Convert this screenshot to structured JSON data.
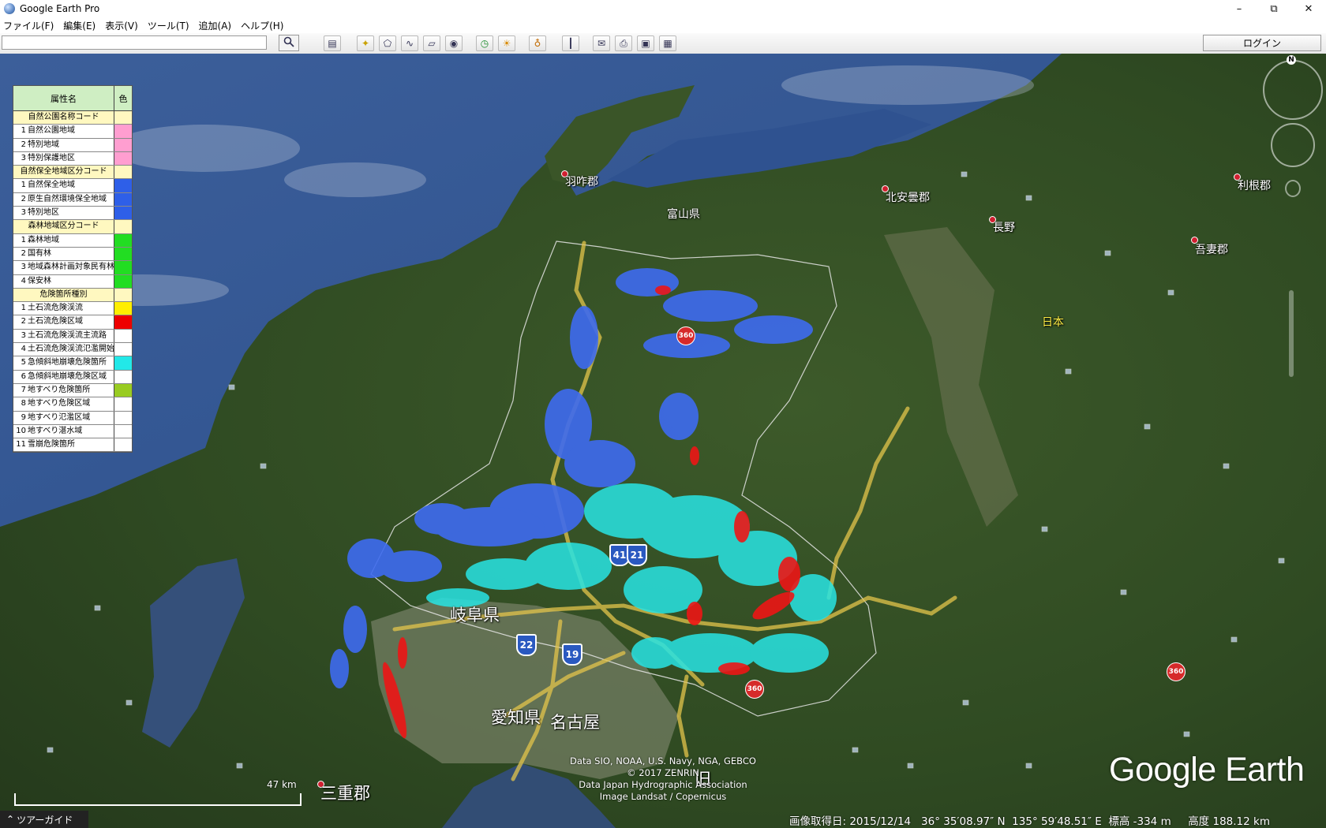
{
  "window": {
    "title": "Google Earth Pro",
    "minimize": "–",
    "restore": "⧉",
    "close": "✕"
  },
  "menu": [
    "ファイル(F)",
    "編集(E)",
    "表示(V)",
    "ツール(T)",
    "追加(A)",
    "ヘルプ(H)"
  ],
  "toolbar": {
    "search_value": "",
    "login_label": "ログイン",
    "buttons": [
      "sidebar-toggle-icon",
      "placemark-icon",
      "polygon-icon",
      "path-icon",
      "overlay-icon",
      "tour-icon",
      "historical-imagery-icon",
      "sunlight-icon",
      "planet-icon",
      "ruler-icon",
      "email-icon",
      "print-icon",
      "save-image-icon",
      "view-in-maps-icon"
    ]
  },
  "legend": {
    "header_name": "属性名",
    "header_color": "色",
    "rows": [
      {
        "type": "section",
        "label": "自然公園名称コード",
        "color": ""
      },
      {
        "type": "item",
        "idx": "1",
        "label": "自然公園地域",
        "color": "#ff9ed0"
      },
      {
        "type": "item",
        "idx": "2",
        "label": "特別地域",
        "color": "#ff9ed0"
      },
      {
        "type": "item",
        "idx": "3",
        "label": "特別保護地区",
        "color": "#ff9ed0"
      },
      {
        "type": "section",
        "label": "自然保全地域区分コード",
        "color": ""
      },
      {
        "type": "item",
        "idx": "1",
        "label": "自然保全地域",
        "color": "#2e5fe8"
      },
      {
        "type": "item",
        "idx": "2",
        "label": "原生自然環境保全地域",
        "color": "#2e5fe8"
      },
      {
        "type": "item",
        "idx": "3",
        "label": "特別地区",
        "color": "#2e5fe8"
      },
      {
        "type": "section",
        "label": "森林地域区分コード",
        "color": ""
      },
      {
        "type": "item",
        "idx": "1",
        "label": "森林地域",
        "color": "#22dd22"
      },
      {
        "type": "item",
        "idx": "2",
        "label": "国有林",
        "color": "#22dd22"
      },
      {
        "type": "item",
        "idx": "3",
        "label": "地域森林計画対象民有林",
        "color": "#22dd22"
      },
      {
        "type": "item",
        "idx": "4",
        "label": "保安林",
        "color": "#22dd22"
      },
      {
        "type": "section",
        "label": "危険箇所種別",
        "color": ""
      },
      {
        "type": "item",
        "idx": "1",
        "label": "土石流危険渓流",
        "color": "#ffee00"
      },
      {
        "type": "item",
        "idx": "2",
        "label": "土石流危険区域",
        "color": "#ee0000"
      },
      {
        "type": "item",
        "idx": "3",
        "label": "土石流危険渓流主流路",
        "color": "#ffffff"
      },
      {
        "type": "item",
        "idx": "4",
        "label": "土石流危険渓流氾濫開始点",
        "color": "#ffffff"
      },
      {
        "type": "item",
        "idx": "5",
        "label": "急傾斜地崩壊危険箇所",
        "color": "#22e8e8"
      },
      {
        "type": "item",
        "idx": "6",
        "label": "急傾斜地崩壊危険区域",
        "color": "#ffffff"
      },
      {
        "type": "item",
        "idx": "7",
        "label": "地すべり危険箇所",
        "color": "#99cc22"
      },
      {
        "type": "item",
        "idx": "8",
        "label": "地すべり危険区域",
        "color": "#ffffff"
      },
      {
        "type": "item",
        "idx": "9",
        "label": "地すべり氾濫区域",
        "color": "#ffffff"
      },
      {
        "type": "item",
        "idx": "10",
        "label": "地すべり湛水域",
        "color": "#ffffff"
      },
      {
        "type": "item",
        "idx": "11",
        "label": "雪崩危険箇所",
        "color": "#ffffff"
      }
    ]
  },
  "places": {
    "hakui": "羽咋郡",
    "toyama": "富山県",
    "kitaazumi": "北安曇郡",
    "nagano": "長野",
    "tone": "利根郡",
    "agatsuma": "吾妻郡",
    "japan": "日本",
    "gifu": "岐阜県",
    "aichi": "愛知県",
    "nagoya": "名古屋",
    "mie": "三重郡",
    "partial": "旧"
  },
  "routes": {
    "r41": "41",
    "r21": "21",
    "r22": "22",
    "r19": "19",
    "r360": "360"
  },
  "attribution": [
    "Data SIO, NOAA, U.S. Navy, NGA, GEBCO",
    "© 2017 ZENRIN",
    "Data Japan Hydrographic Association",
    "Image Landsat / Copernicus"
  ],
  "logo": "Google Earth",
  "scale": {
    "label": "47 km"
  },
  "tour_guide": "ツアーガイド",
  "status": {
    "date": "画像取得日: 2015/12/14",
    "lat": "36° 35′08.97″ N",
    "lon": "135° 59′48.51″ E",
    "elev": "標高 -334 m",
    "alt": "高度 188.12 km"
  },
  "compass": {
    "north": "N"
  },
  "colors": {
    "pink": "#ff9ed0",
    "blue": "#2e5fe8",
    "green": "#22dd22",
    "yellow": "#ffee00",
    "red": "#ee0000",
    "cyan": "#22e8e8",
    "lime": "#99cc22"
  }
}
